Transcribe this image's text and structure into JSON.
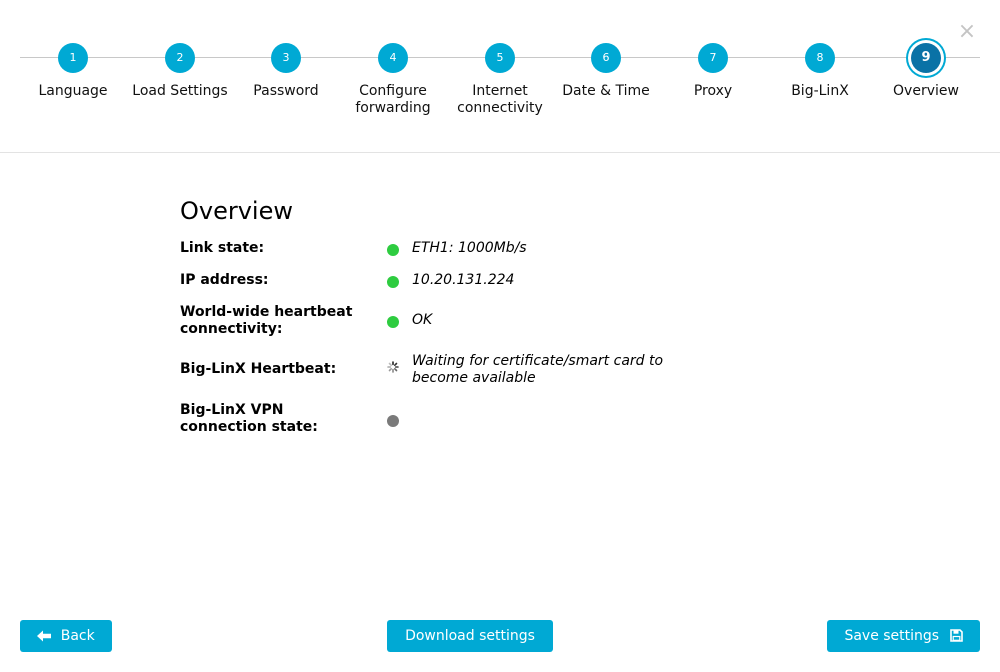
{
  "stepper": {
    "close_icon": "×",
    "steps": [
      {
        "number": "1",
        "label": "Language"
      },
      {
        "number": "2",
        "label": "Load Settings"
      },
      {
        "number": "3",
        "label": "Password"
      },
      {
        "number": "4",
        "label": "Configure forwarding"
      },
      {
        "number": "5",
        "label": "Internet connectivity"
      },
      {
        "number": "6",
        "label": "Date & Time"
      },
      {
        "number": "7",
        "label": "Proxy"
      },
      {
        "number": "8",
        "label": "Big-LinX"
      },
      {
        "number": "9",
        "label": "Overview"
      }
    ],
    "active_step": 9
  },
  "overview": {
    "title": "Overview",
    "rows": [
      {
        "label": "Link state:",
        "status": "green",
        "value": "ETH1: 1000Mb/s"
      },
      {
        "label": "IP address:",
        "status": "green",
        "value": "10.20.131.224"
      },
      {
        "label": "World-wide heartbeat connectivity:",
        "status": "green",
        "value": "OK"
      },
      {
        "label": "Big-LinX Heartbeat:",
        "status": "loading",
        "value": "Waiting for certificate/smart card to become available"
      },
      {
        "label": "Big-LinX VPN connection state:",
        "status": "grey",
        "value": ""
      }
    ]
  },
  "footer": {
    "back_label": "Back",
    "download_label": "Download settings",
    "save_label": "Save settings"
  },
  "colors": {
    "accent": "#00a9d4",
    "active_step": "#0a72a6",
    "status_ok": "#2ecc40",
    "status_unknown": "#7a7a7a"
  },
  "icons": {
    "close": "close-icon",
    "back": "arrow-left-icon",
    "save": "floppy-disk-icon",
    "loading": "spinner-icon"
  }
}
